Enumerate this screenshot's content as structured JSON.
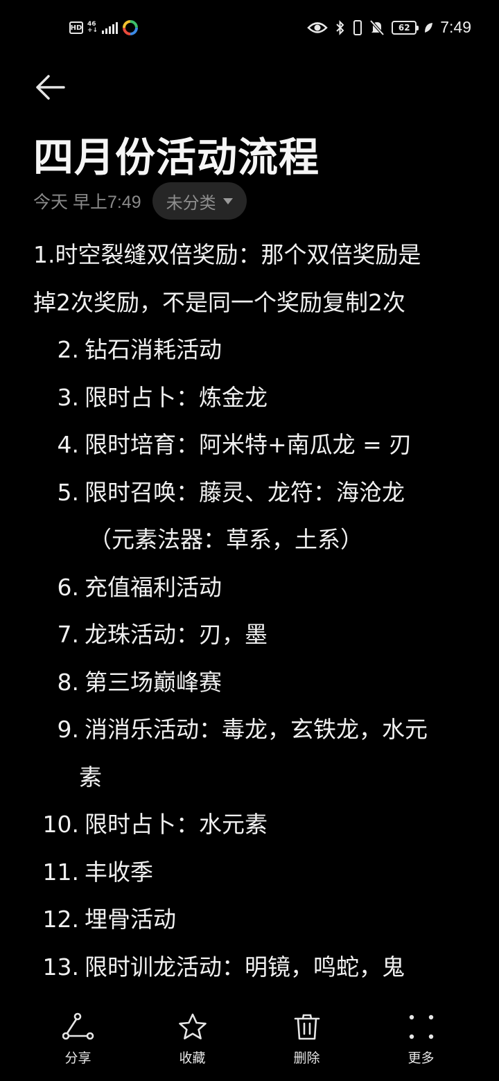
{
  "status_bar": {
    "hd_label": "HD",
    "net_type_top": "46",
    "net_type_bottom": "+↓",
    "battery_level": "62",
    "time": "7:49"
  },
  "note": {
    "title": "四月份活动流程",
    "date": "今天 早上7:49",
    "category": "未分类",
    "first_paragraph": [
      "1.时空裂缝双倍奖励：那个双倍奖励是",
      "掉2次奖励，不是同一个奖励复制2次"
    ],
    "items": [
      {
        "num": "2.",
        "text": "钻石消耗活动"
      },
      {
        "num": "3.",
        "text": "限时占卜：炼金龙"
      },
      {
        "num": "4.",
        "text": "限时培育：阿米特+南瓜龙 = 刃"
      },
      {
        "num": "5.",
        "text": "限时召唤：藤灵、龙符：海沧龙",
        "continuation": "（元素法器：草系，土系）"
      },
      {
        "num": "6.",
        "text": "充值福利活动"
      },
      {
        "num": "7.",
        "text": "龙珠活动：刃，墨"
      },
      {
        "num": "8.",
        "text": "第三场巅峰赛"
      },
      {
        "num": "9.",
        "text": "消消乐活动：毒龙，玄铁龙，水元",
        "continuation": "素"
      },
      {
        "num": "10.",
        "text": "限时占卜：水元素"
      },
      {
        "num": "11.",
        "text": "丰收季"
      },
      {
        "num": "12.",
        "text": "埋骨活动"
      },
      {
        "num": "13.",
        "text": "限时训龙活动：明镜，鸣蛇，鬼"
      }
    ]
  },
  "toolbar": {
    "share": {
      "label": "分享",
      "icon": "share-icon"
    },
    "favorite": {
      "label": "收藏",
      "icon": "star-icon"
    },
    "delete": {
      "label": "删除",
      "icon": "trash-icon"
    },
    "more": {
      "label": "更多",
      "icon": "more-dots-icon"
    }
  }
}
